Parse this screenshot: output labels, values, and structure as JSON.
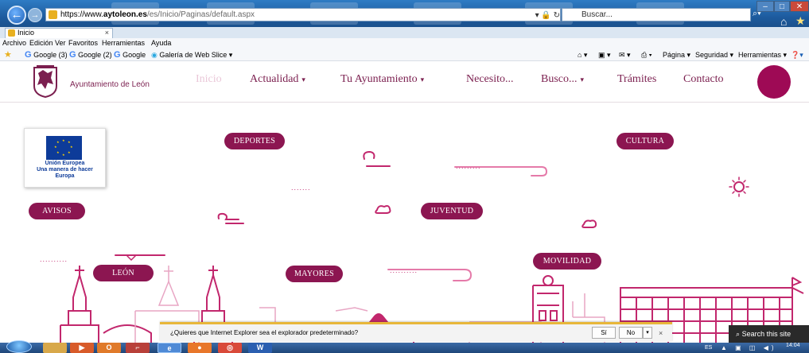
{
  "browser": {
    "url_scheme": "https://www.",
    "url_host": "aytoleon.es",
    "url_rest": "/es/Inicio/Paginas/default.aspx",
    "address_tools": "▾ 🔒 ↻",
    "search_placeholder": "Buscar...",
    "tab_title": "Inicio",
    "tab_close": "×",
    "menu": [
      "Archivo",
      "Edición",
      "Ver",
      "Favoritos",
      "Herramientas",
      "Ayuda"
    ],
    "favorites": [
      "Google (3)",
      "Google (2)",
      "Google",
      "Galería de Web Slice ▾"
    ],
    "commands": [
      "Página ▾",
      "Seguridad ▾",
      "Herramientas ▾"
    ]
  },
  "site": {
    "name": "Ayuntamiento de León",
    "nav": [
      {
        "label": "Inicio",
        "caret": ""
      },
      {
        "label": "Actualidad",
        "caret": "▾"
      },
      {
        "label": "Tu Ayuntamiento",
        "caret": "▾"
      },
      {
        "label": "Necesito...",
        "caret": ""
      },
      {
        "label": "Busco...",
        "caret": "▾"
      },
      {
        "label": "Trámites",
        "caret": ""
      },
      {
        "label": "Contacto",
        "caret": ""
      }
    ],
    "active_nav": "Inicio",
    "brand_color": "#8c1651",
    "eu": {
      "line1": "Unión Europea",
      "line2": "Una manera de hacer",
      "line3": "Europa"
    },
    "categories": {
      "deportes": "DEPORTES",
      "cultura": "CULTURA",
      "avisos": "AVISOS",
      "juventud": "JUVENTUD",
      "leon": "LEÓN",
      "mayores": "MAYORES",
      "movilidad": "MOVILIDAD"
    },
    "search_label": "Search this site"
  },
  "notification": {
    "text": "¿Quieres que Internet Explorer sea el explorador predeterminado?",
    "yes": "Sí",
    "no": "No",
    "dropdown": "▾",
    "close": "×"
  },
  "taskbar": {
    "lang": "ES",
    "clock_time": "14:04"
  }
}
